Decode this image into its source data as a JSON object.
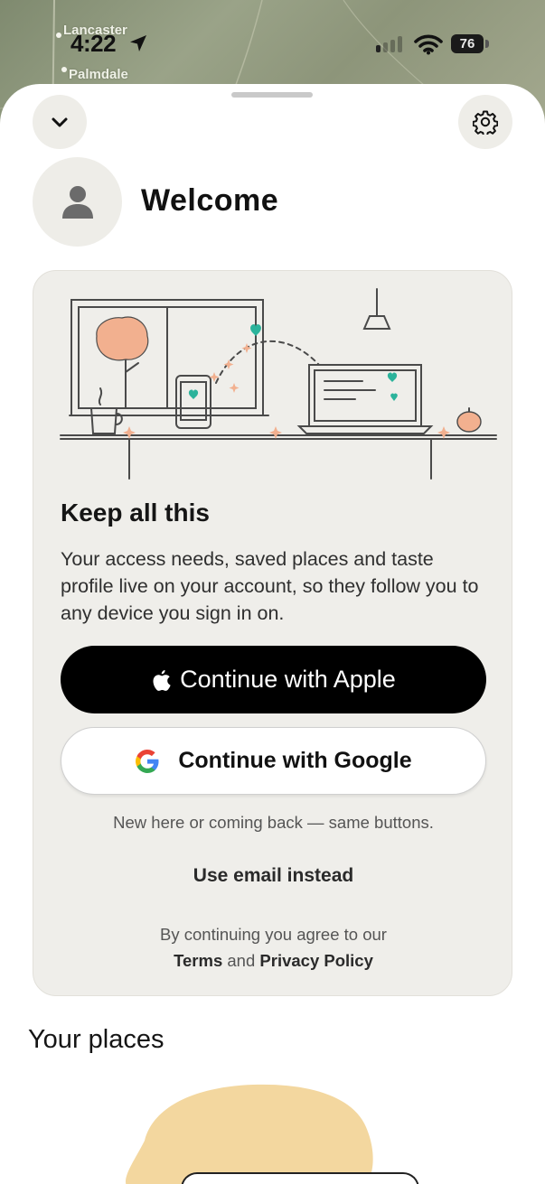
{
  "status_bar": {
    "time": "4:22",
    "battery": "76",
    "icons": [
      "location-arrow-icon",
      "cellular-signal-icon",
      "wifi-icon",
      "battery-icon"
    ]
  },
  "map": {
    "labels": [
      "Lancaster",
      "Palmdale"
    ]
  },
  "header": {
    "collapse_icon": "chevron-down-icon",
    "settings_icon": "gear-icon",
    "avatar_icon": "person-icon",
    "title": "Welcome"
  },
  "account_card": {
    "title": "Keep all this",
    "body": "Your access needs, saved places and taste profile live on your account, so they follow you to any device you sign in on.",
    "apple_button": "Continue with Apple",
    "google_button": "Continue with Google",
    "hint": "New here or coming back — same buttons.",
    "email_link": "Use email instead",
    "legal_prefix": "By continuing you agree to our",
    "terms": "Terms",
    "and": "and",
    "privacy": "Privacy Policy"
  },
  "places": {
    "title": "Your places"
  },
  "colors": {
    "accent_teal": "#2bb39b",
    "accent_peach": "#f2b08f",
    "sheet": "#ffffff",
    "card": "#efeeea"
  }
}
